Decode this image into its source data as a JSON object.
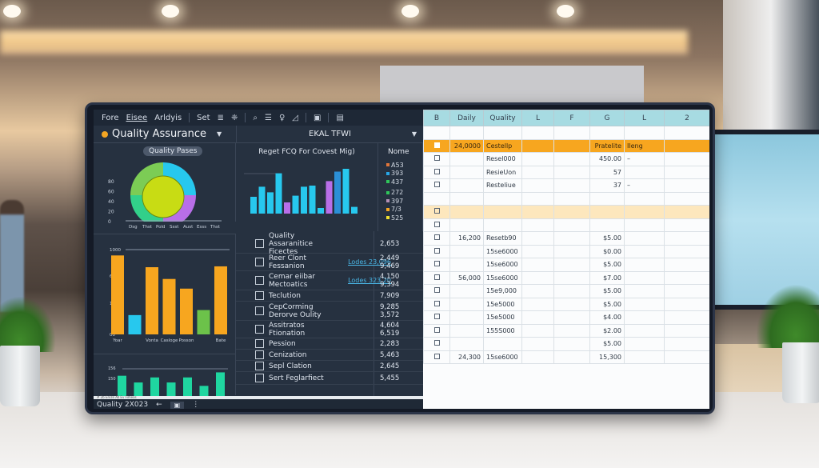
{
  "menubar": {
    "items": [
      "Fore",
      "Eisee",
      "Arldyis"
    ],
    "set_label": "Set",
    "icons": [
      "filter-icon",
      "puzzle-icon",
      "search-icon",
      "list-icon",
      "user-icon",
      "chart-icon",
      "save-icon",
      "graph-icon"
    ]
  },
  "titlebar": {
    "title": "Quality Assurance",
    "center_title": "EKAL TFWI"
  },
  "quality_passes": {
    "pill_label": "Quality Pases",
    "colors": [
      "#27c8ee",
      "#b86ee8",
      "#32d08a",
      "#7ccc55"
    ],
    "center_color": "#c8dc14"
  },
  "request_chart": {
    "title": "Reget FCQ For Covest Mig)"
  },
  "legend": {
    "header": "Nome",
    "items": [
      {
        "label": "A53",
        "color": "#e0763a"
      },
      {
        "label": "393",
        "color": "#27a7e8"
      },
      {
        "label": "437",
        "color": "#2fc65a"
      },
      {
        "label": "272",
        "color": "#2fc65a"
      },
      {
        "label": "397",
        "color": "#b28fb5"
      },
      {
        "label": "7/3",
        "color": "#f5a623"
      },
      {
        "label": "525",
        "color": "#f0e030"
      }
    ]
  },
  "chart_data": [
    {
      "type": "pie",
      "title": "Quality Pases",
      "categories": [
        "Cyan",
        "Purple",
        "Green",
        "Light Green"
      ],
      "values": [
        25,
        25,
        25,
        25
      ],
      "yticks": [
        "0",
        "20",
        "40",
        "60",
        "80"
      ],
      "xticks": [
        "Dsg",
        "Thst",
        "Pold",
        "Ssst",
        "Aust",
        "Esss",
        "Thst"
      ]
    },
    {
      "type": "bar",
      "title": "Reget FCQ For Covest Mig)",
      "series": [
        {
          "name": "values",
          "values": [
            30,
            48,
            38,
            72,
            20,
            32,
            48,
            50,
            10,
            58,
            75,
            80,
            12
          ]
        }
      ],
      "colors": [
        "#27c8ee",
        "#27c8ee",
        "#27c8ee",
        "#27c8ee",
        "#b86ee8",
        "#27c8ee",
        "#27c8ee",
        "#27c8ee",
        "#27c8ee",
        "#b86ee8",
        "#2b8fd6",
        "#27c8ee",
        "#27c8ee"
      ],
      "ylim": [
        0,
        100
      ]
    },
    {
      "type": "bar",
      "title": "",
      "categories": [
        "Yoar",
        "Vonta",
        "Casloge",
        "Posson",
        "Bate"
      ],
      "series": [
        {
          "name": "values",
          "values": [
            940,
            230,
            800,
            660,
            545,
            290,
            810
          ]
        }
      ],
      "bar_labels": [
        "Yoar",
        "",
        "Vonta",
        "Casloge",
        "Posson",
        "",
        "Bate"
      ],
      "colors": [
        "#f7a61f",
        "#27c8ee",
        "#f7a61f",
        "#f7a61f",
        "#f7a61f",
        "#6cc24a",
        "#f7a61f"
      ],
      "yticks": [
        "00",
        "100",
        "600",
        "1000"
      ],
      "ylim": [
        0,
        1000
      ]
    },
    {
      "type": "bar",
      "title": "",
      "series": [
        {
          "name": "values",
          "values": [
            130,
            110,
            125,
            110,
            125,
            100,
            140
          ]
        }
      ],
      "colors": [
        "#1fd6a0",
        "#1fd6a0",
        "#1fd6a0",
        "#1fd6a0",
        "#1fd6a0",
        "#1fd6a0",
        "#1fd6a0"
      ],
      "yticks": [
        "150",
        "156"
      ],
      "ylim": [
        70,
        160
      ]
    }
  ],
  "tasks": [
    {
      "label": "Quality Assaranitice Ficectes",
      "link": "",
      "value": "2,653"
    },
    {
      "label": "Reer Clont Fessanion",
      "link": "Lodes 23,096",
      "value": "2,449\n9,469"
    },
    {
      "label": "Cemar eiibar Mectoatics",
      "link": "Lodes 323.20",
      "value": "4,150\n9,394"
    },
    {
      "label": "Teclution",
      "link": "",
      "value": "7,909"
    },
    {
      "label": "CepCorming Derorve Oulity",
      "link": "",
      "value": "9,285\n3,572"
    },
    {
      "label": "Assitratos Ftionation",
      "link": "",
      "value": "4,604\n6,519"
    },
    {
      "label": "Pession",
      "link": "",
      "value": "2,283"
    },
    {
      "label": "Cenization",
      "link": "",
      "value": "5,463"
    },
    {
      "label": "Sepl Clation",
      "link": "",
      "value": "2,645"
    },
    {
      "label": "Sert Feglarfiect",
      "link": "",
      "value": "5,455"
    }
  ],
  "status_strip": "# 2b  Eriize  All Ev  Fimeos",
  "footer": {
    "label": "Quality 2X023",
    "back_icon": "←",
    "menu_icon": "⋮"
  },
  "sheet": {
    "headers": [
      "B",
      "Daily",
      "Quality",
      "L",
      "F",
      "G",
      "L",
      "2"
    ],
    "rows": [
      {
        "cb": false,
        "daily": "",
        "quality": "",
        "g": "",
        "l": "",
        "style": ""
      },
      {
        "cb": true,
        "daily": "24,0000",
        "quality": "Cestellp",
        "g": "Pratelite",
        "l": "Ileng",
        "style": "hl"
      },
      {
        "cb": true,
        "daily": "",
        "quality": "Resel000",
        "g": "450.00",
        "l": "–",
        "style": ""
      },
      {
        "cb": true,
        "daily": "",
        "quality": "ResieUon",
        "g": "57",
        "l": "",
        "style": ""
      },
      {
        "cb": true,
        "daily": "",
        "quality": "Resteliue",
        "g": "37",
        "l": "–",
        "style": ""
      },
      {
        "cb": false,
        "daily": "",
        "quality": "",
        "g": "",
        "l": "",
        "style": ""
      },
      {
        "cb": true,
        "daily": "",
        "quality": "",
        "g": "",
        "l": "",
        "style": "hl2"
      },
      {
        "cb": true,
        "daily": "",
        "quality": "",
        "g": "",
        "l": "",
        "style": ""
      },
      {
        "cb": true,
        "daily": "16,200",
        "quality": "Resetb90",
        "g": "$5.00",
        "l": "",
        "style": ""
      },
      {
        "cb": true,
        "daily": "",
        "quality": "15se6000",
        "g": "$0.00",
        "l": "",
        "style": ""
      },
      {
        "cb": true,
        "daily": "",
        "quality": "15se6000",
        "g": "$5.00",
        "l": "",
        "style": ""
      },
      {
        "cb": true,
        "daily": "56,000",
        "quality": "15se6000",
        "g": "$7.00",
        "l": "",
        "style": ""
      },
      {
        "cb": true,
        "daily": "",
        "quality": "15e9,000",
        "g": "$5.00",
        "l": "",
        "style": ""
      },
      {
        "cb": true,
        "daily": "",
        "quality": "15e5000",
        "g": "$5.00",
        "l": "",
        "style": ""
      },
      {
        "cb": true,
        "daily": "",
        "quality": "15e5000",
        "g": "$4.00",
        "l": "",
        "style": ""
      },
      {
        "cb": true,
        "daily": "",
        "quality": "155S000",
        "g": "$2.00",
        "l": "",
        "style": ""
      },
      {
        "cb": true,
        "daily": "",
        "quality": "",
        "g": "$5.00",
        "l": "",
        "style": ""
      },
      {
        "cb": true,
        "daily": "24,300",
        "quality": "15se6000",
        "g": "15,300",
        "l": "",
        "style": ""
      }
    ]
  }
}
